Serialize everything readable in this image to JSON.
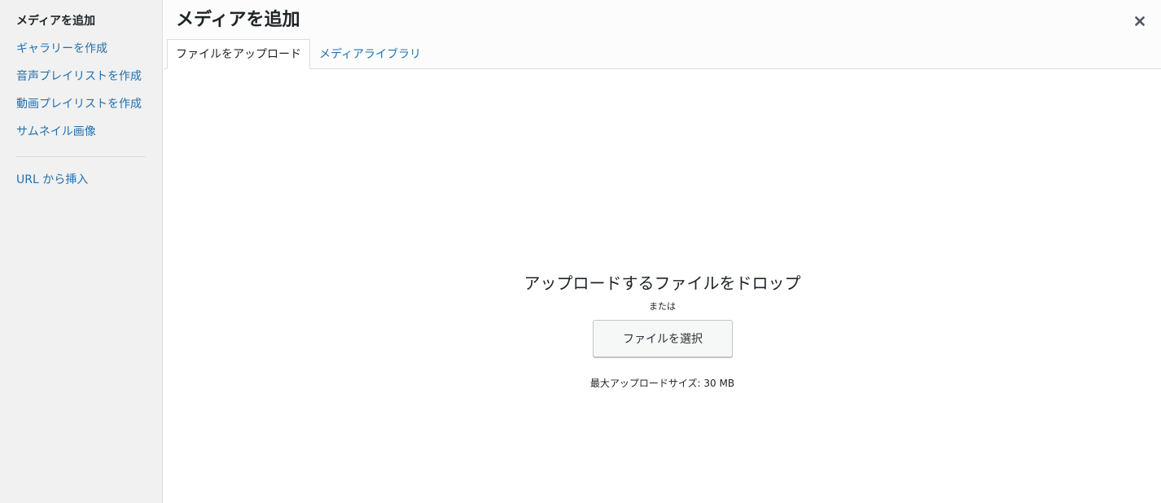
{
  "sidebar": {
    "items": [
      {
        "label": "メディアを追加"
      },
      {
        "label": "ギャラリーを作成"
      },
      {
        "label": "音声プレイリストを作成"
      },
      {
        "label": "動画プレイリストを作成"
      },
      {
        "label": "サムネイル画像"
      },
      {
        "label": "URL から挿入"
      }
    ]
  },
  "header": {
    "title": "メディアを追加",
    "close_icon": "close-icon"
  },
  "tabs": [
    {
      "label": "ファイルをアップロード"
    },
    {
      "label": "メディアライブラリ"
    }
  ],
  "uploader": {
    "drop_text": "アップロードするファイルをドロップ",
    "or_text": "または",
    "select_button": "ファイルを選択",
    "max_size": "最大アップロードサイズ: 30 MB"
  },
  "colors": {
    "link": "#2271b1",
    "text": "#1d2327",
    "sidebar_bg": "#f1f1f1",
    "border": "#dcdcde"
  }
}
